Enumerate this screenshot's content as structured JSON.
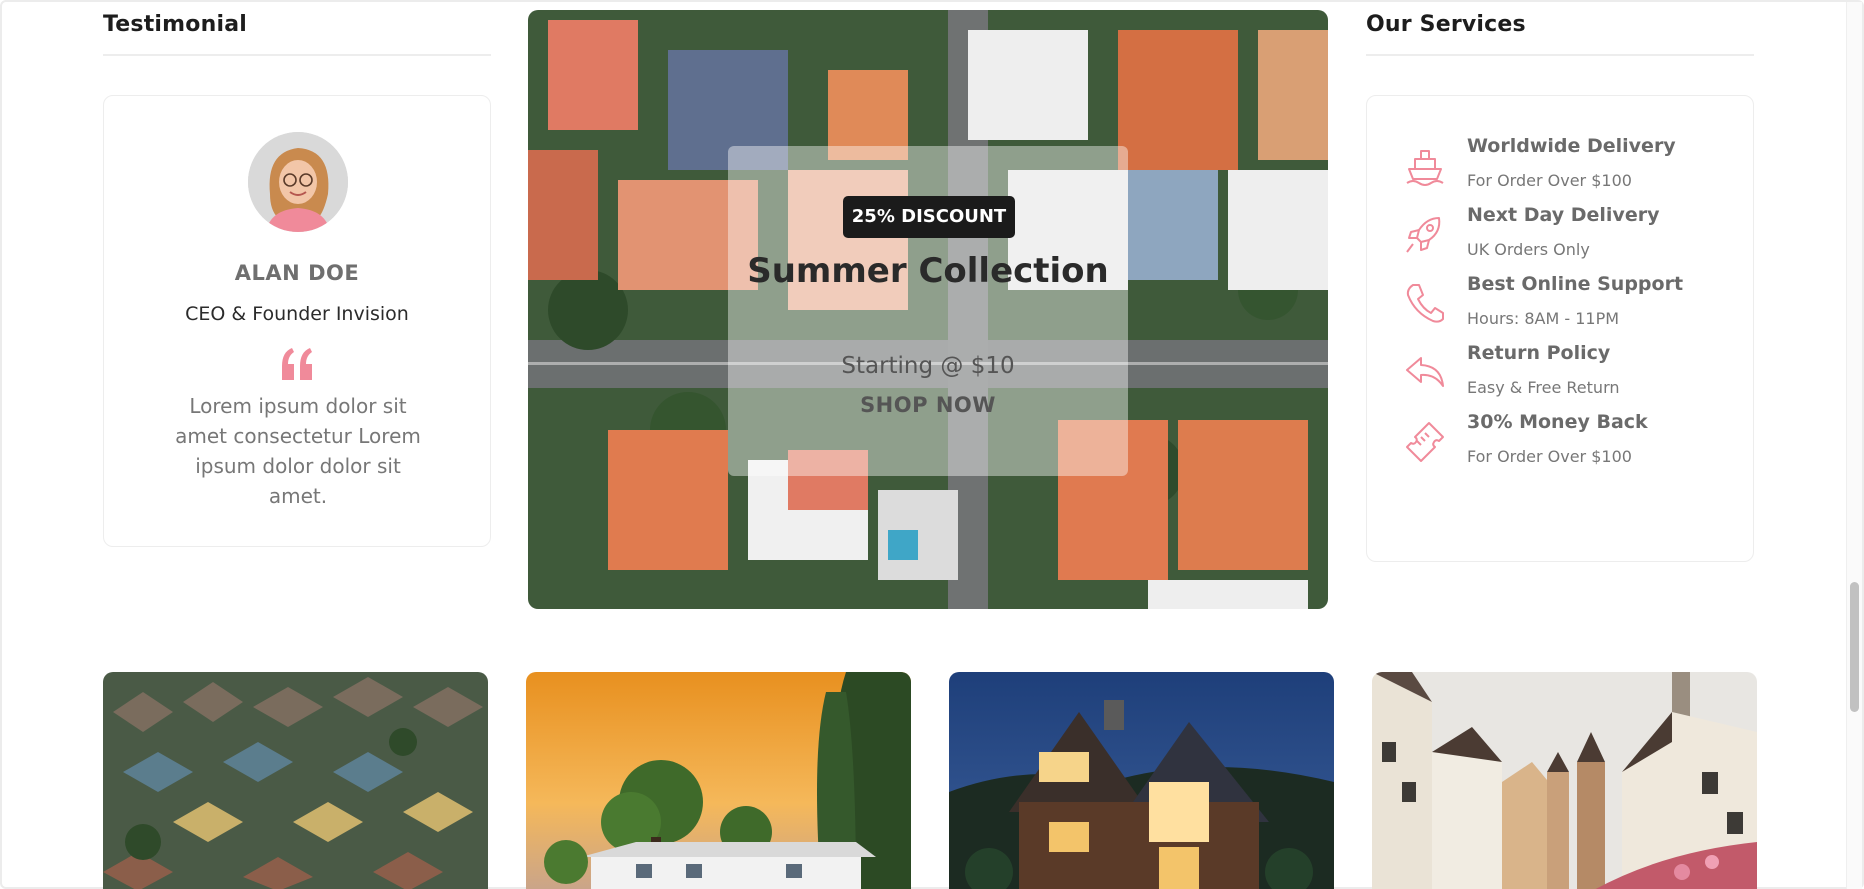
{
  "testimonial": {
    "title": "Testimonial",
    "name": "ALAN DOE",
    "role": "CEO & Founder Invision",
    "quote_icon": "quote-icon",
    "text": "Lorem ipsum dolor sit amet consectetur Lorem ipsum dolor dolor sit amet."
  },
  "banner": {
    "badge": "25% DISCOUNT",
    "title": "Summer Collection",
    "subtitle": "Starting @ $10",
    "cta": "SHOP NOW"
  },
  "services": {
    "title": "Our Services",
    "accent_color": "#f08a9a",
    "items": [
      {
        "icon": "ship-icon",
        "title": "Worldwide Delivery",
        "subtitle": "For Order Over $100"
      },
      {
        "icon": "rocket-icon",
        "title": "Next Day Delivery",
        "subtitle": "UK Orders Only"
      },
      {
        "icon": "phone-icon",
        "title": "Best Online Support",
        "subtitle": "Hours: 8AM - 11PM"
      },
      {
        "icon": "return-arrow-icon",
        "title": "Return Policy",
        "subtitle": "Easy & Free Return"
      },
      {
        "icon": "ticket-icon",
        "title": "30% Money Back",
        "subtitle": "For Order Over $100"
      }
    ]
  },
  "gallery": {
    "tiles": [
      "neighborhood-aerial-image",
      "sunset-house-image",
      "night-cabin-image",
      "old-town-street-image"
    ]
  }
}
